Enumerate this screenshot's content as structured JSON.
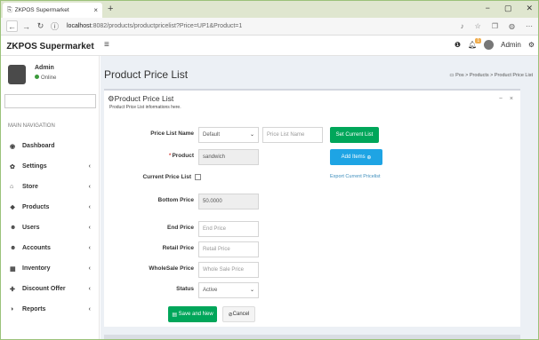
{
  "browser": {
    "tab_title": "ZKPOS Supermarket",
    "tab_close": "×",
    "new_tab": "+",
    "url_host": "localhost",
    "url_rest": ":8082/products/productpricelist?Price=UP1&Product=1",
    "win_min": "−",
    "win_max": "▢",
    "win_close": "✕"
  },
  "header": {
    "brand": "ZKPOS Supermarket",
    "menu_icon": "≡",
    "notification_count": "1",
    "user_name": "Admin"
  },
  "sidebar": {
    "user_name": "Admin",
    "status": "Online",
    "nav_header": "MAIN NAVIGATION",
    "items": [
      {
        "label": "Dashboard",
        "icon": "dashboard-icon",
        "glyph": "◉",
        "has_children": false
      },
      {
        "label": "Settings",
        "icon": "gear-icon",
        "glyph": "✿",
        "has_children": true
      },
      {
        "label": "Store",
        "icon": "store-icon",
        "glyph": "⌂",
        "has_children": true
      },
      {
        "label": "Products",
        "icon": "products-icon",
        "glyph": "❖",
        "has_children": true
      },
      {
        "label": "Users",
        "icon": "users-icon",
        "glyph": "☻",
        "has_children": true
      },
      {
        "label": "Accounts",
        "icon": "accounts-icon",
        "glyph": "☻",
        "has_children": true
      },
      {
        "label": "Inventory",
        "icon": "inventory-icon",
        "glyph": "▦",
        "has_children": true
      },
      {
        "label": "Discount Offer",
        "icon": "plus-icon",
        "glyph": "✚",
        "has_children": true
      },
      {
        "label": "Reports",
        "icon": "reports-icon",
        "glyph": "◑",
        "has_children": true
      }
    ],
    "chevron": "‹"
  },
  "page": {
    "title": "Product Price List",
    "breadcrumb": [
      "Pos",
      "Products",
      "Product Price List"
    ],
    "crumb_sep": ">"
  },
  "box": {
    "title": "Product Price List",
    "subtitle": "Product Price List informations here.",
    "tools_minimize": "−",
    "tools_close": "×"
  },
  "form": {
    "price_list_name_label": "Price List Name",
    "price_list_select_value": "Default",
    "price_list_name_placeholder": "Price List Name",
    "set_current_list_button": "Set Current List",
    "product_label": "Product",
    "product_value": "sandwich",
    "add_items_button": "Add Items",
    "current_price_list_label": "Current Price List",
    "export_link": "Export Current Pricelist",
    "bottom_price_label": "Bottom Price",
    "bottom_price_value": "50.0000",
    "end_price_label": "End Price",
    "end_price_placeholder": "End Price",
    "retail_price_label": "Retail Price",
    "retail_price_placeholder": "Retail Price",
    "wholesale_price_label": "WholeSale Price",
    "wholesale_price_placeholder": "Whole Sale Price",
    "status_label": "Status",
    "status_value": "Active",
    "save_button": "Save and New",
    "cancel_button": "Cancel"
  },
  "colors": {
    "success": "#00a65a",
    "info": "#1ea4e4",
    "link": "#3c8dbc"
  }
}
